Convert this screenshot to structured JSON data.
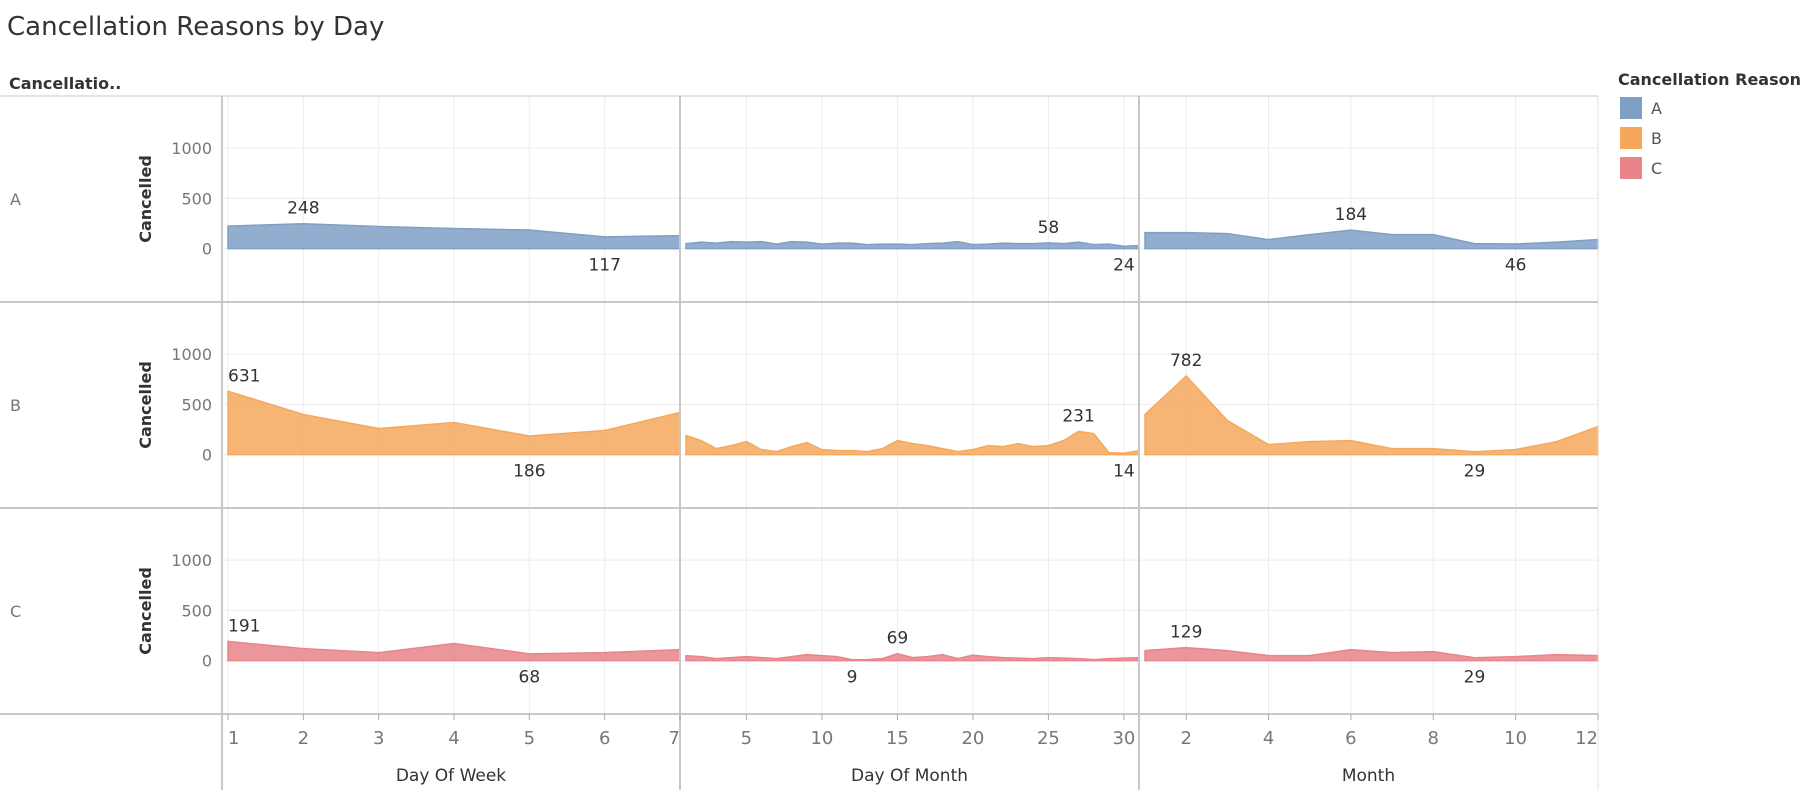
{
  "title": "Cancellation Reasons by Day",
  "row_header": "Cancellatio..",
  "legend": {
    "title": "Cancellation Reason",
    "items": [
      {
        "label": "A",
        "color": "#7f9fc5"
      },
      {
        "label": "B",
        "color": "#f5a85c"
      },
      {
        "label": "C",
        "color": "#e8848a"
      }
    ]
  },
  "y_axis_label": "Cancelled",
  "y_ticks": [
    0,
    500,
    1000
  ],
  "rows": [
    "A",
    "B",
    "C"
  ],
  "columns": [
    {
      "label": "Day Of Week",
      "ticks": [
        "1",
        "2",
        "3",
        "4",
        "5",
        "6",
        "7"
      ]
    },
    {
      "label": "Day Of Month",
      "ticks": [
        "5",
        "10",
        "15",
        "20",
        "25",
        "30"
      ]
    },
    {
      "label": "Month",
      "ticks": [
        "2",
        "4",
        "6",
        "8",
        "10",
        "12"
      ]
    }
  ],
  "chart_data": {
    "type": "area",
    "title": "Cancellation Reasons by Day",
    "ylabel": "Cancelled",
    "ylim": [
      0,
      1400
    ],
    "grid": true,
    "legend_position": "right",
    "row_field": "Cancellation Reason",
    "panels": [
      {
        "xlabel": "Day Of Week",
        "xlim": [
          1,
          7
        ],
        "x": [
          1,
          2,
          3,
          4,
          5,
          6,
          7
        ],
        "series": [
          {
            "name": "A",
            "values": [
              225,
              248,
              220,
              200,
              185,
              117,
              130
            ],
            "labels": [
              {
                "x": 2,
                "value": 248,
                "pos": "above"
              },
              {
                "x": 6,
                "value": 117,
                "pos": "below"
              }
            ]
          },
          {
            "name": "B",
            "values": [
              631,
              400,
              260,
              320,
              186,
              240,
              420
            ],
            "labels": [
              {
                "x": 1,
                "value": 631,
                "pos": "above"
              },
              {
                "x": 5,
                "value": 186,
                "pos": "below"
              }
            ]
          },
          {
            "name": "C",
            "values": [
              191,
              120,
              80,
              170,
              68,
              80,
              110
            ],
            "labels": [
              {
                "x": 1,
                "value": 191,
                "pos": "above"
              },
              {
                "x": 5,
                "value": 68,
                "pos": "below"
              }
            ]
          }
        ]
      },
      {
        "xlabel": "Day Of Month",
        "xlim": [
          1,
          31
        ],
        "x": [
          1,
          2,
          3,
          4,
          5,
          6,
          7,
          8,
          9,
          10,
          11,
          12,
          13,
          14,
          15,
          16,
          17,
          18,
          19,
          20,
          21,
          22,
          23,
          24,
          25,
          26,
          27,
          28,
          29,
          30,
          31
        ],
        "series": [
          {
            "name": "A",
            "values": [
              50,
              65,
              55,
              70,
              65,
              70,
              45,
              70,
              65,
              45,
              55,
              55,
              40,
              45,
              45,
              40,
              50,
              55,
              70,
              40,
              45,
              55,
              50,
              50,
              58,
              50,
              65,
              40,
              45,
              24,
              30
            ],
            "labels": [
              {
                "x": 25,
                "value": 58,
                "pos": "above"
              },
              {
                "x": 30,
                "value": 24,
                "pos": "below"
              }
            ]
          },
          {
            "name": "B",
            "values": [
              190,
              140,
              60,
              90,
              130,
              50,
              30,
              80,
              120,
              50,
              40,
              40,
              30,
              60,
              140,
              110,
              90,
              60,
              30,
              50,
              90,
              80,
              110,
              80,
              90,
              140,
              231,
              210,
              20,
              14,
              40
            ],
            "labels": [
              {
                "x": 27,
                "value": 231,
                "pos": "above"
              },
              {
                "x": 30,
                "value": 14,
                "pos": "below"
              }
            ]
          },
          {
            "name": "C",
            "values": [
              50,
              40,
              20,
              30,
              40,
              30,
              20,
              40,
              60,
              50,
              40,
              9,
              10,
              20,
              69,
              30,
              40,
              60,
              20,
              55,
              40,
              30,
              25,
              20,
              30,
              25,
              20,
              10,
              20,
              25,
              30
            ],
            "labels": [
              {
                "x": 15,
                "value": 69,
                "pos": "above"
              },
              {
                "x": 12,
                "value": 9,
                "pos": "below"
              }
            ]
          }
        ]
      },
      {
        "xlabel": "Month",
        "xlim": [
          1,
          12
        ],
        "x": [
          1,
          2,
          3,
          4,
          5,
          6,
          7,
          8,
          9,
          10,
          11,
          12
        ],
        "series": [
          {
            "name": "A",
            "values": [
              160,
              160,
              150,
              90,
              140,
              184,
              140,
              140,
              50,
              46,
              65,
              90
            ],
            "labels": [
              {
                "x": 6,
                "value": 184,
                "pos": "above"
              },
              {
                "x": 10,
                "value": 46,
                "pos": "below"
              }
            ]
          },
          {
            "name": "B",
            "values": [
              400,
              782,
              340,
              100,
              130,
              140,
              60,
              60,
              29,
              50,
              130,
              280
            ],
            "labels": [
              {
                "x": 2,
                "value": 782,
                "pos": "above"
              },
              {
                "x": 9,
                "value": 29,
                "pos": "below"
              }
            ]
          },
          {
            "name": "C",
            "values": [
              100,
              129,
              100,
              50,
              50,
              110,
              80,
              90,
              29,
              40,
              60,
              50
            ],
            "labels": [
              {
                "x": 2,
                "value": 129,
                "pos": "above"
              },
              {
                "x": 9,
                "value": 29,
                "pos": "below"
              }
            ]
          }
        ]
      }
    ]
  }
}
